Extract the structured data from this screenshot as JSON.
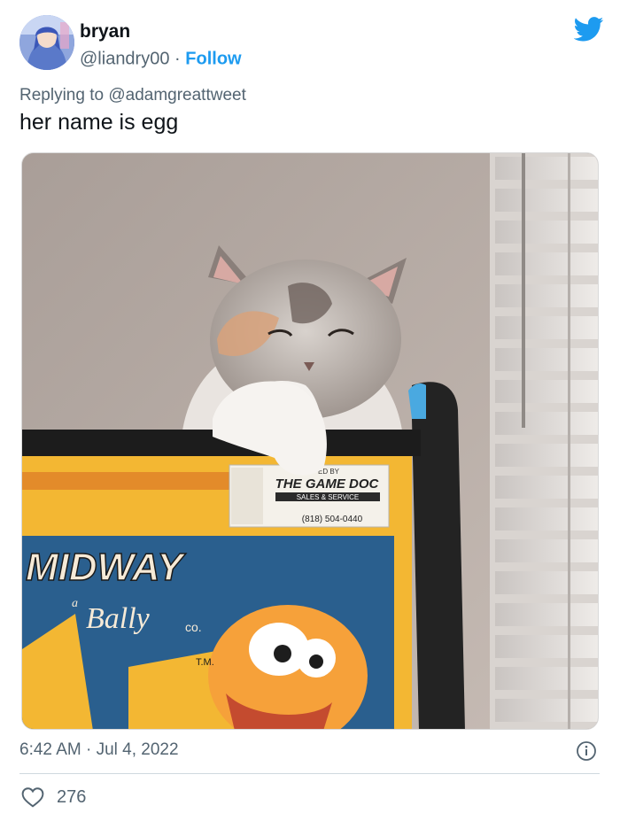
{
  "author": {
    "name": "bryan",
    "handle": "@liandry00",
    "separator": "·",
    "follow_label": "Follow"
  },
  "brand_icon": "twitter-bird-icon",
  "reply": {
    "prefix": "Replying to",
    "mention": "@adamgreattweet"
  },
  "tweet_text": "her name is egg",
  "media": {
    "photo_signage": {
      "sticker_line1": "ED BY",
      "sticker_line2": "THE GAME DOC",
      "sticker_line3": "SALES & SERVICE",
      "sticker_phone": "(818) 504-0440",
      "marquee_brand": "MIDWAY",
      "marquee_sub": "Bally",
      "marquee_co": "co.",
      "marquee_tm": "T.M.",
      "marquee_a": "a"
    }
  },
  "timestamp": {
    "time": "6:42 AM",
    "separator": "·",
    "date": "Jul 4, 2022"
  },
  "engagement": {
    "like_icon": "heart-icon",
    "like_count": "276",
    "info_icon": "info-icon"
  },
  "colors": {
    "twitter_blue": "#1d9bf0",
    "secondary_text": "#536471",
    "primary_text": "#0f1419"
  }
}
